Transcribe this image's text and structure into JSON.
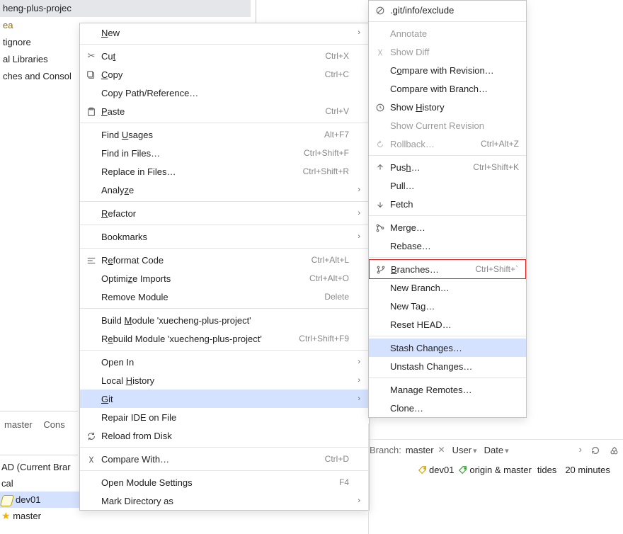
{
  "tree": {
    "project": "heng-plus-projec",
    "idea": "ea",
    "gitignore": "tignore",
    "externalLibs": "al Libraries",
    "scratches": "ches and Consol"
  },
  "tabs": {
    "t1": "master",
    "t2": "Cons"
  },
  "lowerList": {
    "head": "AD (Current Brar",
    "local": "cal",
    "dev01": "dev01",
    "master": "master"
  },
  "ctx": {
    "new_": "New",
    "cut": "Cut",
    "cut_sc": "Ctrl+X",
    "copy": "Copy",
    "copy_sc": "Ctrl+C",
    "copyPath": "Copy Path/Reference…",
    "paste": "Paste",
    "paste_sc": "Ctrl+V",
    "findUsages": "Find Usages",
    "findUsages_sc": "Alt+F7",
    "findInFiles": "Find in Files…",
    "findInFiles_sc": "Ctrl+Shift+F",
    "replaceInFiles": "Replace in Files…",
    "replaceInFiles_sc": "Ctrl+Shift+R",
    "analyze": "Analyze",
    "refactor": "Refactor",
    "bookmarks": "Bookmarks",
    "reformat": "Reformat Code",
    "reformat_sc": "Ctrl+Alt+L",
    "optimize": "Optimize Imports",
    "optimize_sc": "Ctrl+Alt+O",
    "removeMod": "Remove Module",
    "removeMod_sc": "Delete",
    "buildMod": "Build Module 'xuecheng-plus-project'",
    "rebuildMod": "Rebuild Module 'xuecheng-plus-project'",
    "rebuildMod_sc": "Ctrl+Shift+F9",
    "openIn": "Open In",
    "localHist": "Local History",
    "git": "Git",
    "repairIDE": "Repair IDE on File",
    "reload": "Reload from Disk",
    "compare": "Compare With…",
    "compare_sc": "Ctrl+D",
    "openModSet": "Open Module Settings",
    "openModSet_sc": "F4",
    "markDir": "Mark Directory as"
  },
  "sub": {
    "exclude": ".git/info/exclude",
    "annotate": "Annotate",
    "showDiff": "Show Diff",
    "compareRev": "Compare with Revision…",
    "compareBranch": "Compare with Branch…",
    "showHist": "Show History",
    "showCurRev": "Show Current Revision",
    "rollback": "Rollback…",
    "rollback_sc": "Ctrl+Alt+Z",
    "push": "Push…",
    "push_sc": "Ctrl+Shift+K",
    "pull": "Pull…",
    "fetch": "Fetch",
    "merge": "Merge…",
    "rebase": "Rebase…",
    "branches": "Branches…",
    "branches_sc": "Ctrl+Shift+`",
    "newBranch": "New Branch…",
    "newTag": "New Tag…",
    "resetHead": "Reset HEAD…",
    "stash": "Stash Changes…",
    "unstash": "Unstash Changes…",
    "manageRemotes": "Manage Remotes…",
    "clone": "Clone…"
  },
  "filter": {
    "branchLabel": "Branch:",
    "branchVal": "master",
    "userLabel": "User",
    "dateLabel": "Date"
  },
  "log": {
    "tag1": "dev01",
    "tag2": "origin & master",
    "msg": "tides",
    "age": "20 minutes"
  }
}
